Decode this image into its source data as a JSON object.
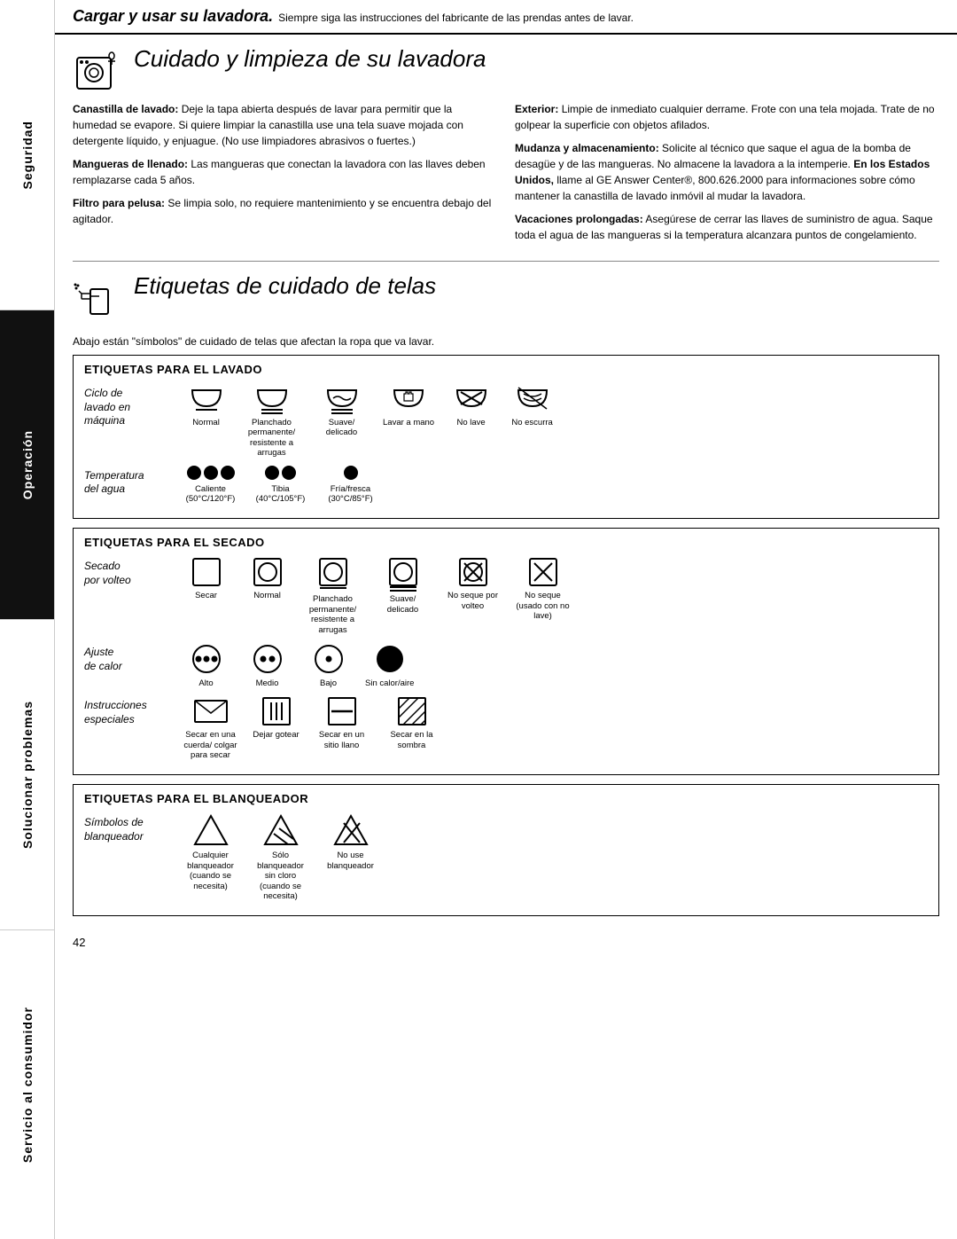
{
  "header": {
    "title_bold": "Cargar y usar su lavadora.",
    "subtitle": "Siempre siga las instrucciones del fabricante de las prendas antes de lavar."
  },
  "section1": {
    "title": "Cuidado y limpieza de su lavadora",
    "col_left": [
      {
        "lead": "Canastilla de lavado:",
        "text": " Deje la tapa abierta después de lavar para permitir que la humedad se evapore. Si quiere limpiar la canastilla use una tela suave mojada con detergente líquido, y enjuague. (No use limpiadores abrasivos o fuertes.)"
      },
      {
        "lead": "Mangueras de llenado:",
        "text": " Las mangueras que conectan la lavadora con las llaves deben remplazarse cada 5 años."
      },
      {
        "lead": "Filtro para pelusa:",
        "text": " Se limpia solo, no requiere mantenimiento y se encuentra debajo del agitador."
      }
    ],
    "col_right": [
      {
        "lead": "Exterior:",
        "text": " Limpie de inmediato cualquier derrame. Frote con una tela mojada. Trate de no golpear la superficie con objetos afilados."
      },
      {
        "lead": "Mudanza y almacenamiento:",
        "text": " Solicite al técnico que saque el agua de la bomba de desagüe y de las mangueras. No almacene la lavadora a la intemperie. En los Estados Unidos, llame al GE Answer Center®, 800.626.2000 para informaciones sobre cómo mantener la canastilla de lavado inmóvil al mudar la lavadora."
      },
      {
        "lead": "Vacaciones prolongadas:",
        "text": " Asegúrese de cerrar las llaves de suministro de agua. Saque toda el agua de las mangueras si la temperatura alcanzara puntos de congelamiento."
      }
    ]
  },
  "section2": {
    "title": "Etiquetas de cuidado de telas",
    "intro": "Abajo están \"símbolos\" de cuidado de telas que afectan la ropa que va lavar.",
    "lavado_title": "ETIQUETAS PARA EL LAVADO",
    "lavado_rows": [
      {
        "label": "Ciclo de lavado en máquina",
        "icons": [
          {
            "type": "wash_normal",
            "label": "Normal"
          },
          {
            "type": "wash_permanent",
            "label": "Planchado permanente/ resistente a arrugas"
          },
          {
            "type": "wash_delicate",
            "label": "Suave/ delicado"
          },
          {
            "type": "wash_hand",
            "label": "Lavar a mano"
          },
          {
            "type": "wash_no",
            "label": "No lave"
          },
          {
            "type": "wash_nodrip",
            "label": "No escurra"
          }
        ]
      },
      {
        "label": "Temperatura del agua",
        "icons": [
          {
            "type": "temp_hot",
            "label": "Caliente (50°C/120°F)"
          },
          {
            "type": "temp_warm",
            "label": "Tibia (40°C/105°F)"
          },
          {
            "type": "temp_cold",
            "label": "Fría/fresca (30°C/85°F)"
          }
        ]
      }
    ],
    "secado_title": "ETIQUETAS PARA EL SECADO",
    "secado_rows": [
      {
        "label": "Secado por volteo",
        "icons": [
          {
            "type": "dry_dry",
            "label": "Secar"
          },
          {
            "type": "dry_normal",
            "label": "Normal"
          },
          {
            "type": "dry_permanent",
            "label": "Planchado permanente/ resistente a arrugas"
          },
          {
            "type": "dry_delicate",
            "label": "Suave/ delicado"
          },
          {
            "type": "dry_no",
            "label": "No seque por volteo"
          },
          {
            "type": "dry_nox",
            "label": "No seque (usado con no lave)"
          }
        ]
      },
      {
        "label": "Ajuste de calor",
        "icons": [
          {
            "type": "heat_high",
            "label": "Alto"
          },
          {
            "type": "heat_medium",
            "label": "Medio"
          },
          {
            "type": "heat_low",
            "label": "Bajo"
          },
          {
            "type": "heat_none",
            "label": "Sin calor/aire"
          }
        ]
      },
      {
        "label": "Instrucciones especiales",
        "icons": [
          {
            "type": "special_line",
            "label": "Secar en una cuerda/ colgar para secar"
          },
          {
            "type": "special_drip",
            "label": "Dejar gotear"
          },
          {
            "type": "special_flat",
            "label": "Secar en un sitio llano"
          },
          {
            "type": "special_shade",
            "label": "Secar en la sombra"
          }
        ]
      }
    ],
    "blanqueador_title": "ETIQUETAS PARA EL BLANQUEADOR",
    "blanqueador_rows": [
      {
        "label": "Símbolos de blanqueador",
        "icons": [
          {
            "type": "bleach_any",
            "label": "Cualquier blanqueador (cuando se necesita)"
          },
          {
            "type": "bleach_nonchlor",
            "label": "Sólo blanqueador sin cloro (cuando se necesita)"
          },
          {
            "type": "bleach_no",
            "label": "No use blanqueador"
          }
        ]
      }
    ]
  },
  "sidebar": {
    "sections": [
      "Seguridad",
      "Operación",
      "Solucionar problemas",
      "Servicio al consumidor"
    ]
  },
  "page_number": "42"
}
